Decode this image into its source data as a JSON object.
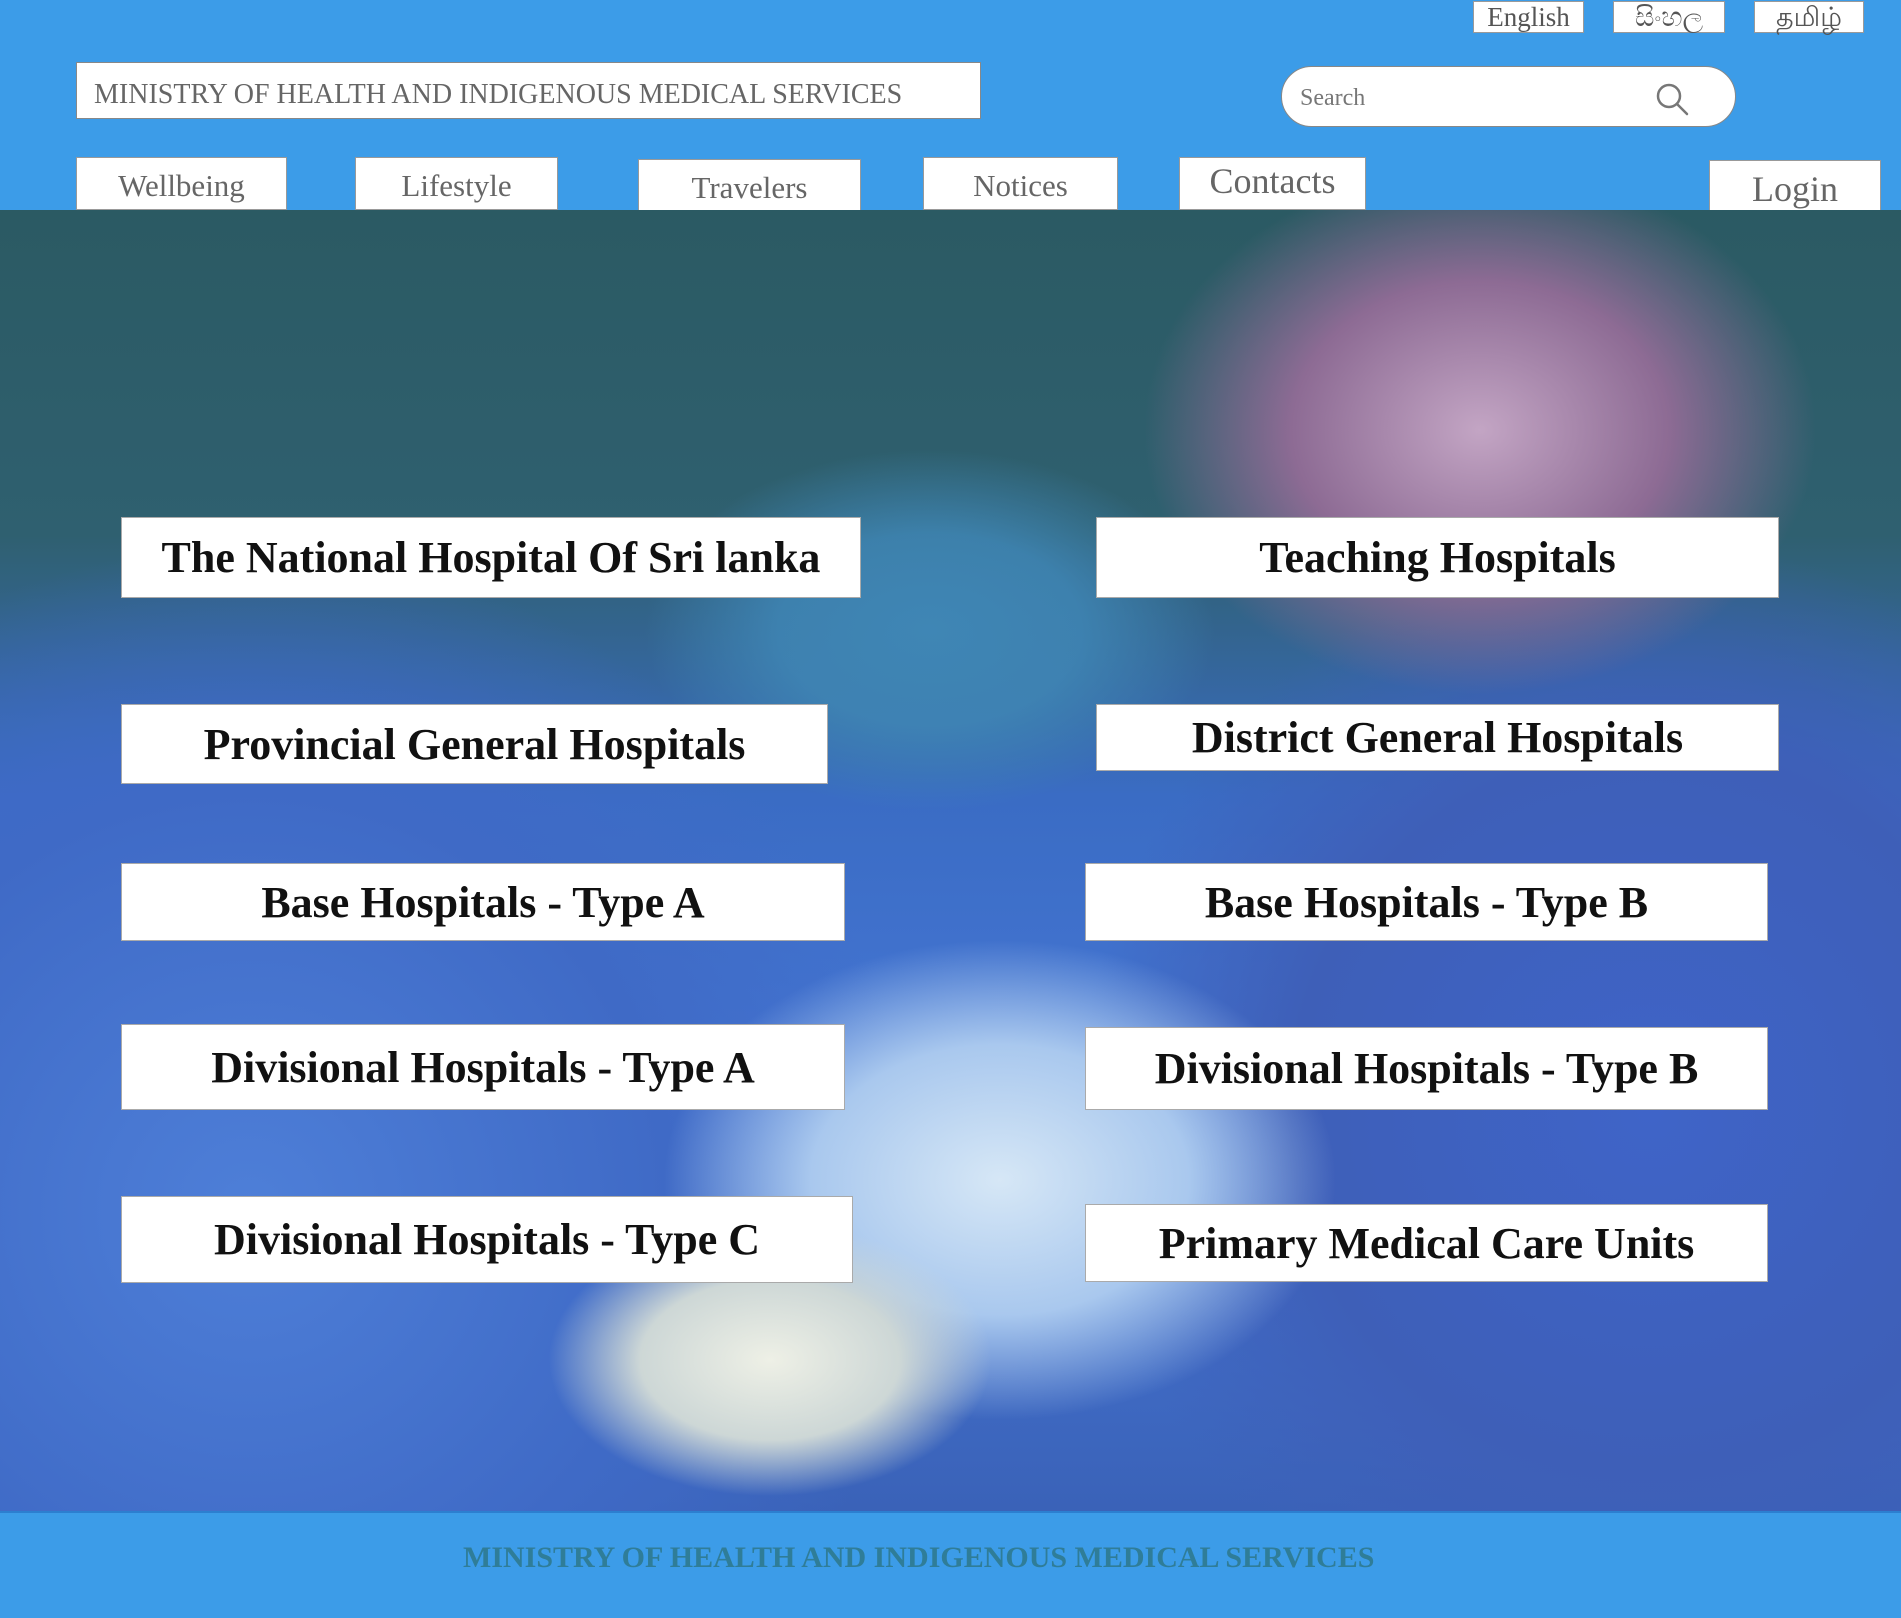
{
  "languages": [
    "English",
    "සිංහල",
    "தமிழ்"
  ],
  "site_title": "MINISTRY OF HEALTH AND INDIGENOUS MEDICAL SERVICES",
  "search": {
    "placeholder": "Search"
  },
  "nav": {
    "wellbeing": "Wellbeing",
    "lifestyle": "Lifestyle",
    "travelers": "Travelers",
    "notices": "Notices",
    "contacts": "Contacts",
    "login": "Login"
  },
  "hospitals": {
    "national": "The National Hospital Of Sri lanka",
    "teaching": "Teaching Hospitals",
    "provincial": "Provincial General Hospitals",
    "district": "District General Hospitals",
    "base_a": "Base Hospitals - Type A",
    "base_b": "Base Hospitals - Type B",
    "divisional_a": "Divisional Hospitals - Type A",
    "divisional_b": "Divisional Hospitals - Type B",
    "divisional_c": "Divisional Hospitals - Type C",
    "primary": "Primary Medical Care Units"
  },
  "footer": {
    "text": "MINISTRY OF HEALTH AND INDIGENOUS MEDICAL SERVICES"
  }
}
